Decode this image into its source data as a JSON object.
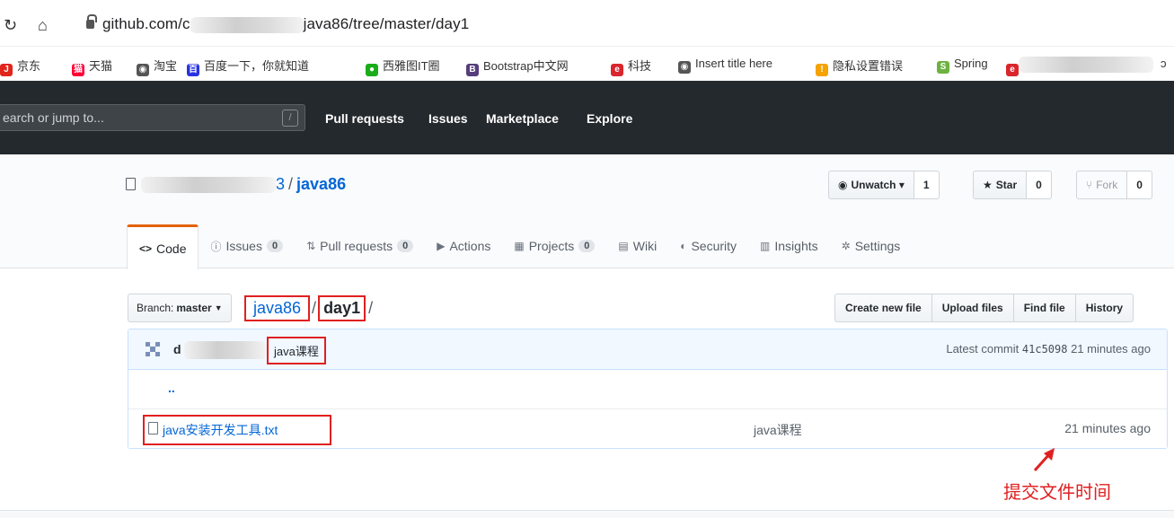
{
  "browser": {
    "url_prefix": "github.com/c",
    "url_suffix": "java86/tree/master/day1",
    "bookmarks": [
      {
        "label": "京东",
        "icon": "jd-icon",
        "color": "#e1251b",
        "glyph": "J"
      },
      {
        "label": "天猫",
        "icon": "tmall-icon",
        "color": "#ff0036",
        "glyph": "猫"
      },
      {
        "label": "淘宝",
        "icon": "globe-icon",
        "color": "#555555",
        "glyph": "◉"
      },
      {
        "label": "百度一下，你就知道",
        "icon": "baidu-icon",
        "color": "#2932e1",
        "glyph": "百"
      },
      {
        "label": "西雅图IT圈",
        "icon": "wechat-icon",
        "color": "#1aad19",
        "glyph": "●"
      },
      {
        "label": "Bootstrap中文网",
        "icon": "bootstrap-icon",
        "color": "#563d7c",
        "glyph": "B"
      },
      {
        "label": "科技",
        "icon": "ie-icon",
        "color": "#d9262c",
        "glyph": "e"
      },
      {
        "label": "Insert title here",
        "icon": "globe-icon",
        "color": "#555555",
        "glyph": "◉"
      },
      {
        "label": "隐私设置错误",
        "icon": "warning-icon",
        "color": "#f5a300",
        "glyph": "!"
      },
      {
        "label": "Spring",
        "icon": "spring-icon",
        "color": "#6db33f",
        "glyph": "S"
      },
      {
        "label": "百",
        "icon": "ie-icon",
        "color": "#d9262c",
        "glyph": "e"
      }
    ]
  },
  "gh": {
    "search_placeholder": "earch or jump to...",
    "slash": "/",
    "nav": [
      "Pull requests",
      "Issues",
      "Marketplace",
      "Explore"
    ]
  },
  "repo": {
    "owner_tail": "3",
    "sep": "/",
    "name": "java86",
    "unwatch": "Unwatch ▾",
    "watch_count": "1",
    "star": "Star",
    "star_count": "0",
    "fork": "Fork",
    "fork_count": "0"
  },
  "tabs": [
    {
      "label": "Code",
      "icon": "<>",
      "badge": null,
      "selected": true
    },
    {
      "label": "Issues",
      "icon": "ⓘ",
      "badge": "0",
      "selected": false
    },
    {
      "label": "Pull requests",
      "icon": "⇅",
      "badge": "0",
      "selected": false
    },
    {
      "label": "Actions",
      "icon": "▶",
      "badge": null,
      "selected": false
    },
    {
      "label": "Projects",
      "icon": "▦",
      "badge": "0",
      "selected": false
    },
    {
      "label": "Wiki",
      "icon": "▤",
      "badge": null,
      "selected": false
    },
    {
      "label": "Security",
      "icon": "◐",
      "badge": null,
      "selected": false
    },
    {
      "label": "Insights",
      "icon": "▥",
      "badge": null,
      "selected": false
    },
    {
      "label": "Settings",
      "icon": "✲",
      "badge": null,
      "selected": false
    }
  ],
  "filenav": {
    "branch_label": "Branch:",
    "branch": "master",
    "crumb_repo": "java86",
    "crumb_sep": "/",
    "crumb_dir": "day1",
    "crumb_tail": "/",
    "buttons": [
      "Create new file",
      "Upload files",
      "Find file",
      "History"
    ]
  },
  "commit": {
    "author_initial": "d",
    "message": "java课程",
    "latest_label": "Latest commit",
    "sha": "41c5098",
    "age": "21 minutes ago"
  },
  "files": [
    {
      "name": "..",
      "is_parent": true,
      "message": "",
      "age": ""
    },
    {
      "name": "java安装开发工具.txt",
      "is_parent": false,
      "message": "java课程",
      "age": "21 minutes ago"
    }
  ],
  "annotation": {
    "text": "提交文件时间",
    "color": "#e02020"
  }
}
